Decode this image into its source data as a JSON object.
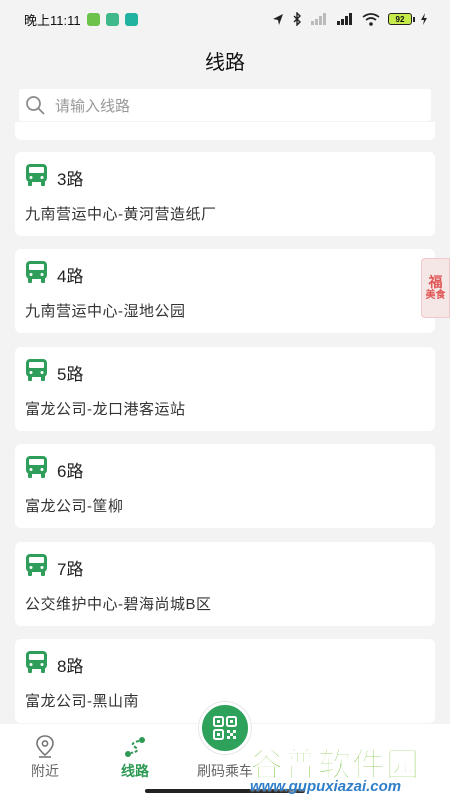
{
  "status_bar": {
    "time": "晚上11:11",
    "battery": "92"
  },
  "header": {
    "title": "线路"
  },
  "search": {
    "placeholder": "请输入线路"
  },
  "routes": [
    {
      "name": "3路",
      "desc": "九南营运中心-黄河营造纸厂"
    },
    {
      "name": "4路",
      "desc": "九南营运中心-湿地公园"
    },
    {
      "name": "5路",
      "desc": "富龙公司-龙口港客运站"
    },
    {
      "name": "6路",
      "desc": "富龙公司-筐柳"
    },
    {
      "name": "7路",
      "desc": "公交维护中心-碧海尚城B区"
    },
    {
      "name": "8路",
      "desc": "富龙公司-黑山南"
    }
  ],
  "promo": {
    "line1": "福",
    "line2": "美食"
  },
  "nav": {
    "nearby": "附近",
    "lines": "线路",
    "scan": "刷码乘车"
  },
  "watermark": {
    "main": "谷普软件园",
    "url": "www.gupuxiazai.com"
  },
  "colors": {
    "accent": "#2e9a55",
    "bus_icon": "#2f9e5a"
  }
}
